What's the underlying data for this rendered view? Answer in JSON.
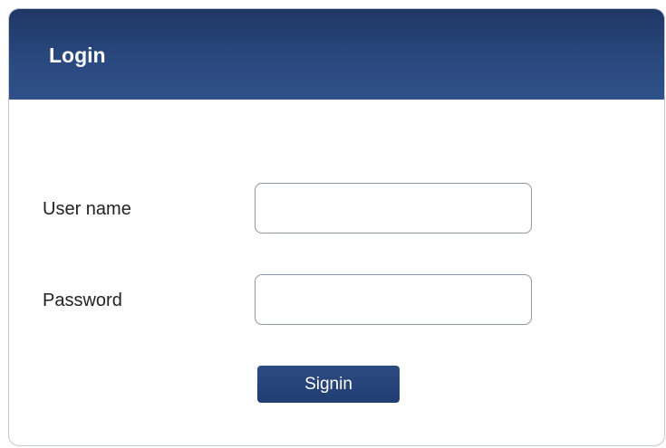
{
  "header": {
    "title": "Login"
  },
  "form": {
    "username_label": "User name",
    "username_value": "",
    "username_placeholder": "",
    "password_label": "Password",
    "password_value": "",
    "password_placeholder": "",
    "signin_label": "Signin"
  },
  "colors": {
    "header_background": "#2a4a80",
    "button_background": "#243f72",
    "input_border": "#8a96a6",
    "panel_border": "#c6cbd3"
  }
}
